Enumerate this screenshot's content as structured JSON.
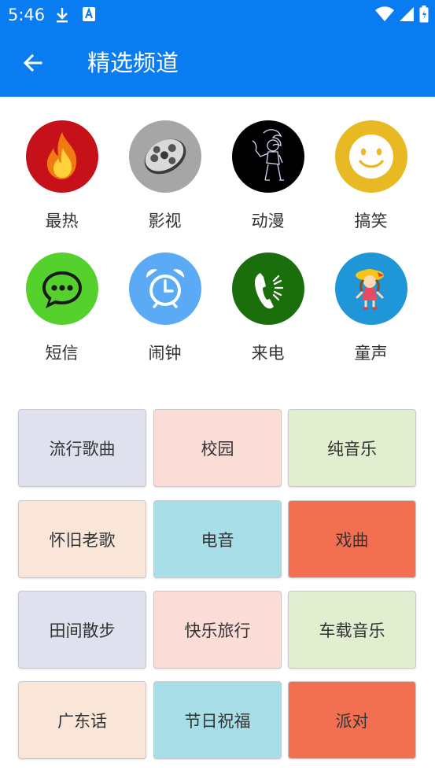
{
  "status_bar": {
    "time": "5:46",
    "left_icons": [
      "download-icon",
      "a-icon"
    ],
    "right_icons": [
      "wifi-icon",
      "signal-icon",
      "battery-icon"
    ]
  },
  "app_bar": {
    "back_icon": "arrow-left-icon",
    "title": "精选频道"
  },
  "channels": [
    {
      "label": "最热",
      "icon": "fire-icon",
      "bg": "#c6101a"
    },
    {
      "label": "影视",
      "icon": "film-reel-icon",
      "bg": "#a6a6a6"
    },
    {
      "label": "动漫",
      "icon": "anime-character-icon",
      "bg": "#000000"
    },
    {
      "label": "搞笑",
      "icon": "smiley-icon",
      "bg": "#e8b923"
    },
    {
      "label": "短信",
      "icon": "message-bubble-icon",
      "bg": "#54d12c"
    },
    {
      "label": "闹钟",
      "icon": "alarm-clock-icon",
      "bg": "#5aaaf5"
    },
    {
      "label": "来电",
      "icon": "phone-ringing-icon",
      "bg": "#1a6e0c"
    },
    {
      "label": "童声",
      "icon": "child-icon",
      "bg": "#1e96d8"
    }
  ],
  "tiles": [
    {
      "label": "流行歌曲",
      "bg": "#dfe2ee"
    },
    {
      "label": "校园",
      "bg": "#fcdcd7"
    },
    {
      "label": "纯音乐",
      "bg": "#e1eecf"
    },
    {
      "label": "怀旧老歌",
      "bg": "#f9e6d9"
    },
    {
      "label": "电音",
      "bg": "#a7dee8"
    },
    {
      "label": "戏曲",
      "bg": "#f36f52"
    },
    {
      "label": "田间散步",
      "bg": "#dfe2ee"
    },
    {
      "label": "快乐旅行",
      "bg": "#fcdcd7"
    },
    {
      "label": "车载音乐",
      "bg": "#e1eecf"
    },
    {
      "label": "广东话",
      "bg": "#f9e6d9"
    },
    {
      "label": "节日祝福",
      "bg": "#a7dee8"
    },
    {
      "label": "派对",
      "bg": "#f36f52"
    }
  ]
}
